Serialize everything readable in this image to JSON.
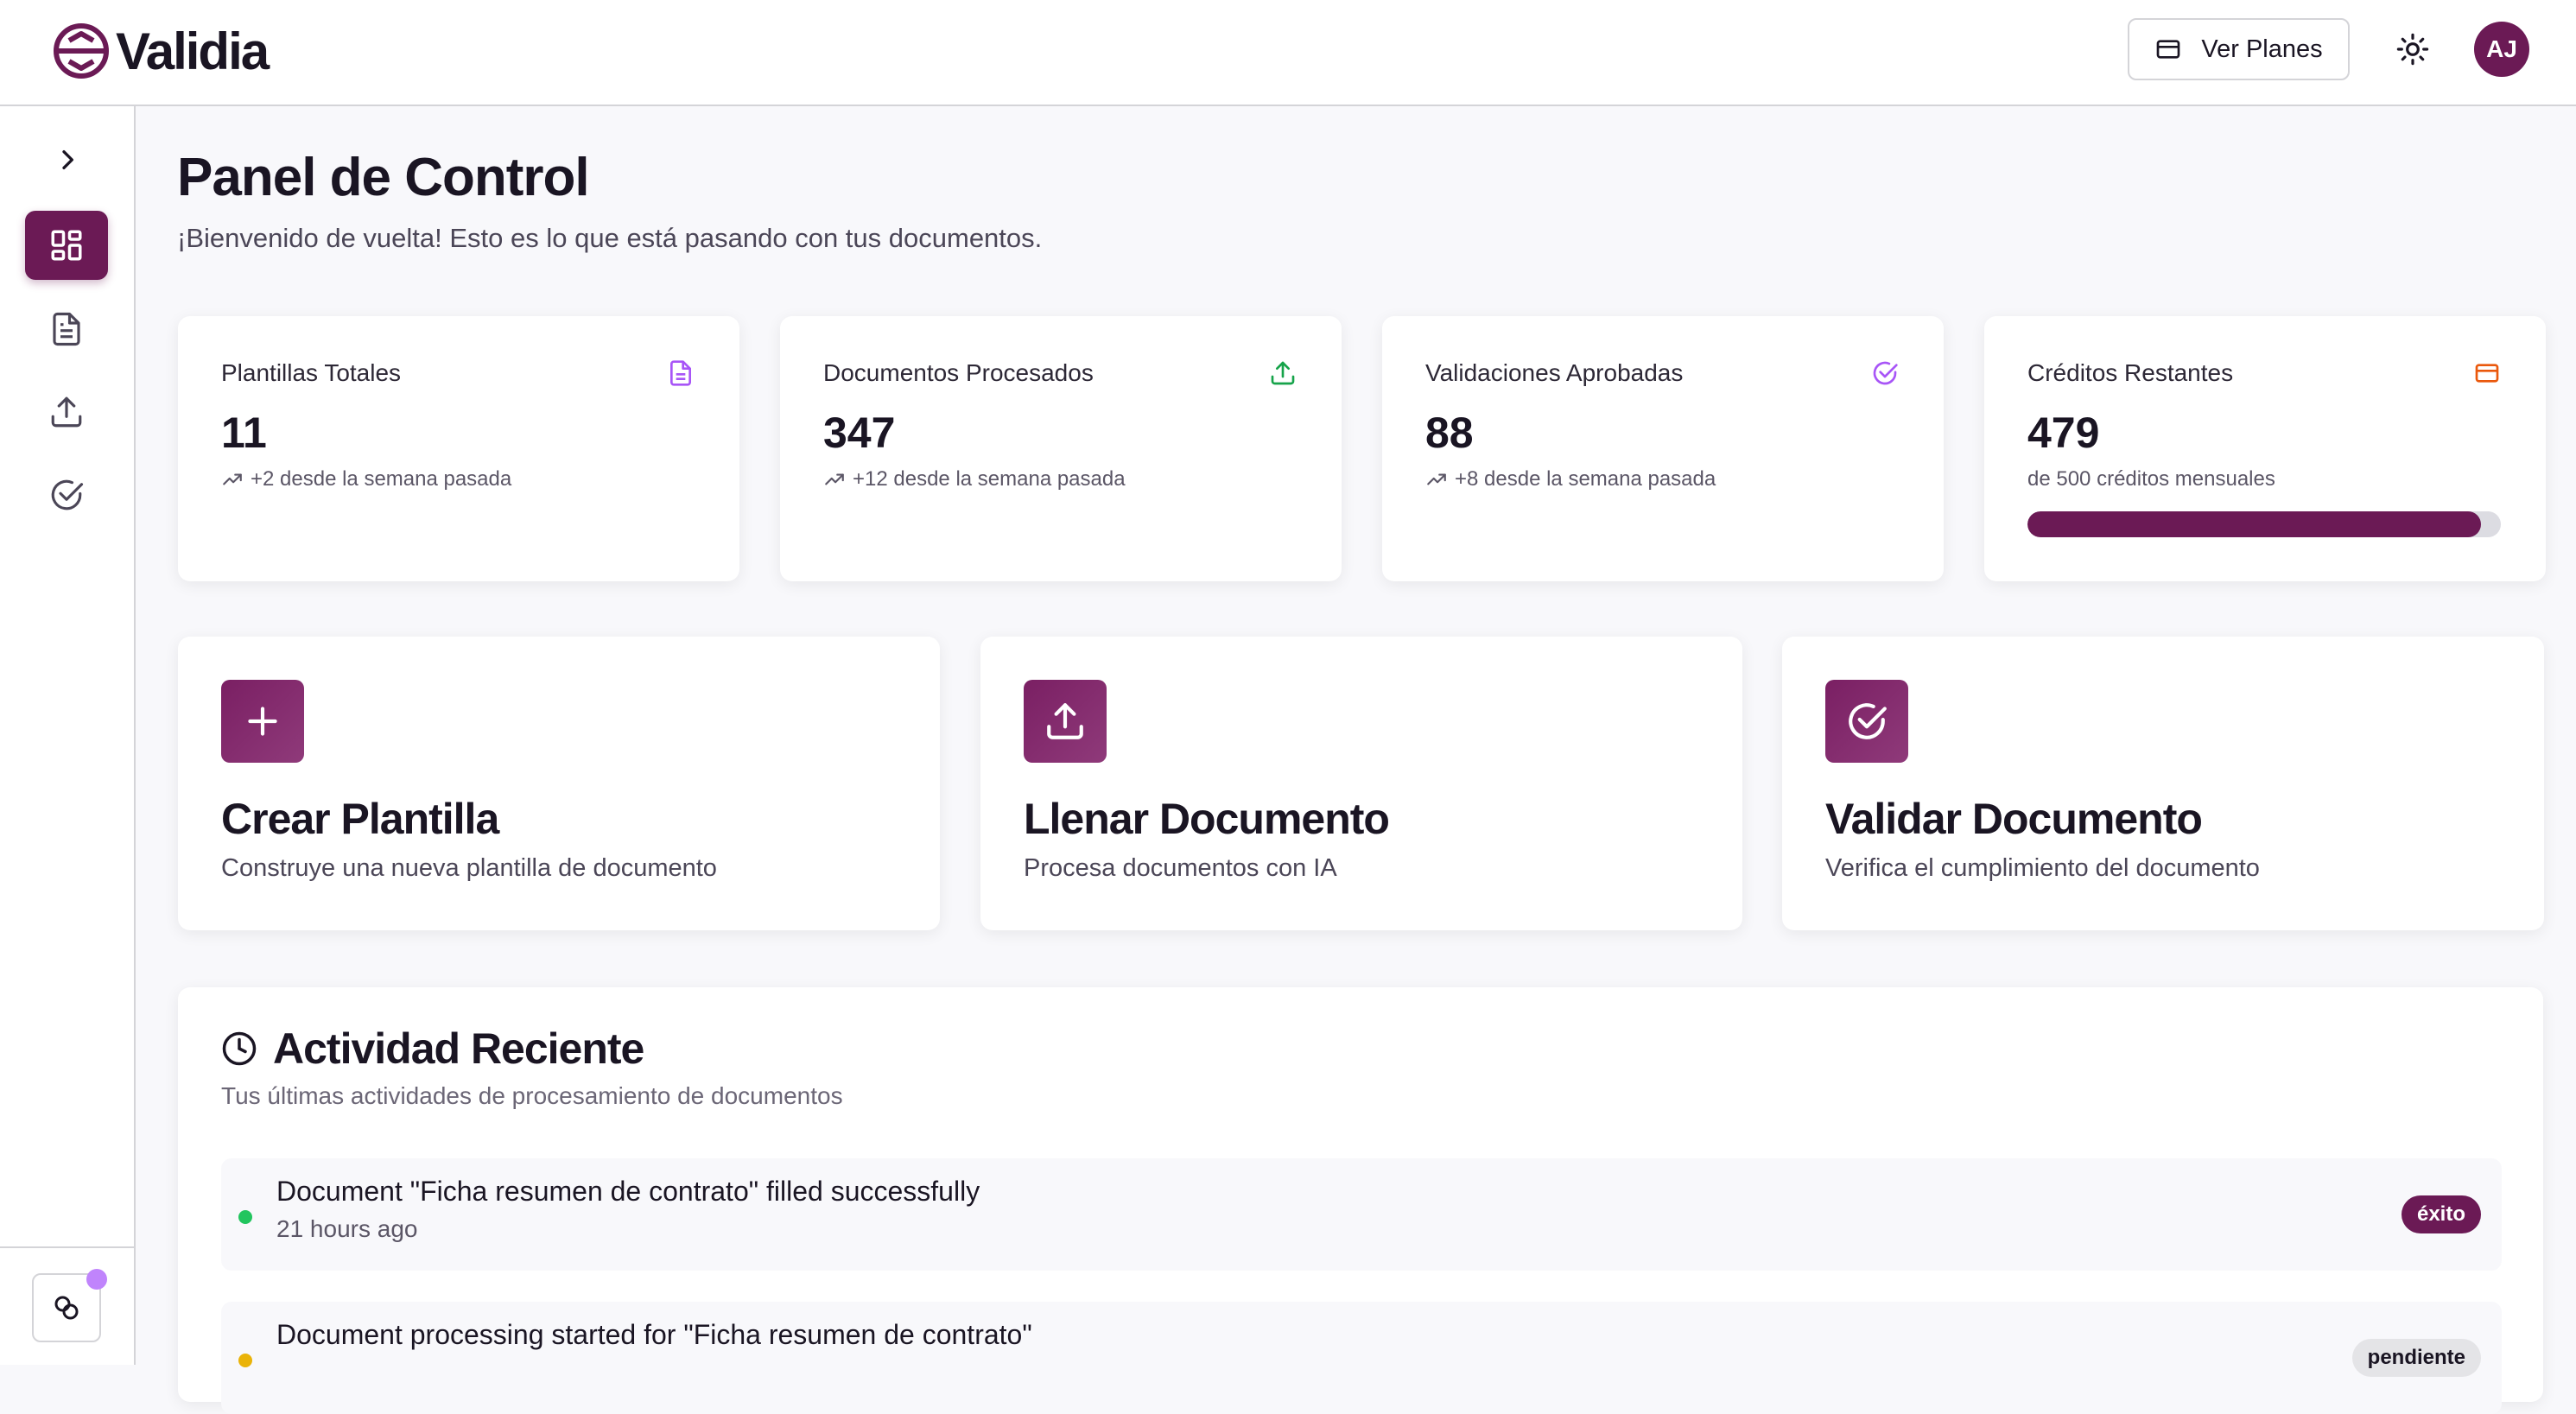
{
  "header": {
    "logo_text": "Validia",
    "plans_button": "Ver Planes",
    "avatar_initials": "AJ"
  },
  "page": {
    "title": "Panel de Control",
    "subtitle": "¡Bienvenido de vuelta! Esto es lo que está pasando con tus documentos."
  },
  "stats": [
    {
      "label": "Plantillas Totales",
      "value": "11",
      "trend": "+2 desde la semana pasada",
      "icon": "document-icon",
      "color": "#a855f7"
    },
    {
      "label": "Documentos Procesados",
      "value": "347",
      "trend": "+12 desde la semana pasada",
      "icon": "upload-icon",
      "color": "#16a34a"
    },
    {
      "label": "Validaciones Aprobadas",
      "value": "88",
      "trend": "+8 desde la semana pasada",
      "icon": "check-circle-icon",
      "color": "#a855f7"
    },
    {
      "label": "Créditos Restantes",
      "value": "479",
      "note": "de 500 créditos mensuales",
      "progress": 0.958,
      "icon": "credit-card-icon",
      "color": "#ea580c"
    }
  ],
  "actions": [
    {
      "title": "Crear Plantilla",
      "description": "Construye una nueva plantilla de documento",
      "icon": "plus-icon"
    },
    {
      "title": "Llenar Documento",
      "description": "Procesa documentos con IA",
      "icon": "upload-icon"
    },
    {
      "title": "Validar Documento",
      "description": "Verifica el cumplimiento del documento",
      "icon": "check-circle-icon"
    }
  ],
  "activity": {
    "title": "Actividad Reciente",
    "subtitle": "Tus últimas actividades de procesamiento de documentos",
    "items": [
      {
        "text": "Document \"Ficha resumen de contrato\" filled successfully",
        "time": "21 hours ago",
        "status": "éxito",
        "dot_color": "#22c55e",
        "badge_bg": "#6b1a55",
        "badge_fg": "#ffffff"
      },
      {
        "text": "Document processing started for \"Ficha resumen de contrato\"",
        "time": "",
        "status": "pendiente",
        "dot_color": "#eab308",
        "badge_bg": "#e4e4e7",
        "badge_fg": "#1a1523"
      }
    ]
  },
  "colors": {
    "brand": "#6b1a55"
  }
}
